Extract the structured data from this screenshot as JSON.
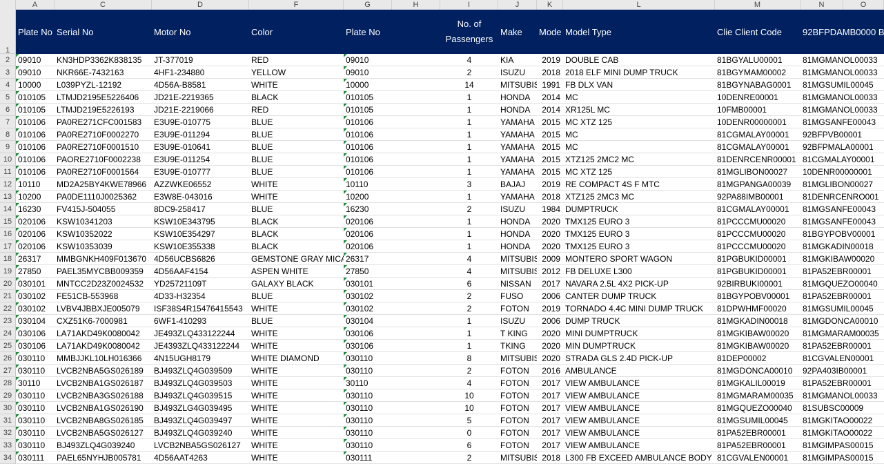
{
  "column_letters": [
    "A",
    "C",
    "D",
    "F",
    "G",
    "H",
    "I",
    "J",
    "K",
    "L",
    "M",
    "N",
    "O"
  ],
  "header": {
    "plate_no": "Plate No",
    "serial_no": "Serial No",
    "motor_no": "Motor No",
    "color": "Color",
    "plate_no_2": "Plate No",
    "passengers": "No. of Passengers",
    "make": "Make",
    "model_year": "Mode",
    "model_type": "Model Type",
    "client": "Clie Client Code",
    "code2": "92BFPDAMB0000 B"
  },
  "header_fill": "#002060",
  "rows": [
    {
      "n": "2",
      "plate": "09010",
      "serial": "KN3HDP3362K838135",
      "motor": "JT-377019",
      "color": "RED",
      "plate2": "09010",
      "pax": "4",
      "make": "KIA",
      "year": "2019",
      "type": "DOUBLE CAB",
      "client": "81BGYALU00001",
      "code2": "81MGMANOL00033"
    },
    {
      "n": "3",
      "plate": "09010",
      "serial": "NKR66E-7432163",
      "motor": "4HF1-234880",
      "color": "YELLOW",
      "plate2": "09010",
      "pax": "2",
      "make": "ISUZU",
      "year": "2018",
      "type": "2018 ELF MINI DUMP TRUCK",
      "client": "81BGYMAM00002",
      "code2": "81MGMANOL00033"
    },
    {
      "n": "4",
      "plate": "10000",
      "serial": "L039PYZL-12192",
      "motor": "4D56A-B8581",
      "color": "WHITE",
      "plate2": "10000",
      "pax": "14",
      "make": "MITSUBISHI",
      "year": "1991",
      "type": "FB DLX VAN",
      "client": "81BGYNABAG0001",
      "code2": "81MGSUMIL00045"
    },
    {
      "n": "5",
      "plate": "010105",
      "serial": "LTMJD2195E5226406",
      "motor": "JD21E-2219365",
      "color": "BLACK",
      "plate2": "010105",
      "pax": "1",
      "make": "HONDA",
      "year": "2014",
      "type": "MC",
      "client": "10DENRE00001",
      "code2": "81MGMANOL00033"
    },
    {
      "n": "6",
      "plate": "010105",
      "serial": "LTMJD219E5226193",
      "motor": "JD21E-2219066",
      "color": "RED",
      "plate2": "010105",
      "pax": "1",
      "make": "HONDA",
      "year": "2014",
      "type": "XR125L MC",
      "client": "10FMB00001",
      "code2": "81MGMANOL00033"
    },
    {
      "n": "7",
      "plate": "010106",
      "serial": "PA0RE271CFC001583",
      "motor": "E3U9E-010775",
      "color": "BLUE",
      "plate2": "010106",
      "pax": "1",
      "make": "YAMAHA",
      "year": "2015",
      "type": "MC XTZ 125",
      "client": "10DENR00000001",
      "code2": "81MGSANFE00043"
    },
    {
      "n": "8",
      "plate": "010106",
      "serial": "PA0RE2710F0002270",
      "motor": "E3U9E-011294",
      "color": "BLUE",
      "plate2": "010106",
      "pax": "1",
      "make": "YAMAHA",
      "year": "2015",
      "type": "MC",
      "client": "81CGMALAY00001",
      "code2": "92BFPVB00001"
    },
    {
      "n": "9",
      "plate": "010106",
      "serial": "PA0RE2710F0001510",
      "motor": "E3U9E-010641",
      "color": "BLUE",
      "plate2": "010106",
      "pax": "1",
      "make": "YAMAHA",
      "year": "2015",
      "type": "MC",
      "client": "81CGMALAY00001",
      "code2": "92BFPMALA00001"
    },
    {
      "n": "10",
      "plate": "010106",
      "serial": "PAORE2710F0002238",
      "motor": "E3U9E-011254",
      "color": "BLUE",
      "plate2": "010106",
      "pax": "1",
      "make": "YAMAHA",
      "year": "2015",
      "type": "XTZ125  2MC2  MC",
      "client": "81DENRCENR00001",
      "code2": "81CGMALAY00001"
    },
    {
      "n": "11",
      "plate": "010106",
      "serial": "PA0RE2710F0001564",
      "motor": "E3U9E-010777",
      "color": "BLUE",
      "plate2": "010106",
      "pax": "1",
      "make": "YAMAHA",
      "year": "2015",
      "type": "MC XTZ 125",
      "client": "81MGLIBON00027",
      "code2": "10DENR00000001"
    },
    {
      "n": "12",
      "plate": "10110",
      "serial": "MD2A25BY4KWE78966",
      "motor": "AZZWKE06552",
      "color": "WHITE",
      "plate2": "10110",
      "pax": "3",
      "make": "BAJAJ",
      "year": "2019",
      "type": "RE COMPACT 4S F MTC",
      "client": "81MGPANGA00039",
      "code2": "81MGLIBON00027"
    },
    {
      "n": "13",
      "plate": "10200",
      "serial": "PA0DE1110J0025362",
      "motor": "E3W8E-043016",
      "color": "WHITE",
      "plate2": "10200",
      "pax": "1",
      "make": "YAMAHA",
      "year": "2018",
      "type": "XTZ125 2MC3 MC",
      "client": "92PA88IMB00001",
      "code2": "81DENRCENRO001"
    },
    {
      "n": "14",
      "plate": "16230",
      "serial": "FV415J-504055",
      "motor": "8DC9-258417",
      "color": "BLUE",
      "plate2": "16230",
      "pax": "2",
      "make": "ISUZU",
      "year": "1984",
      "type": "DUMPTRUCK",
      "client": "81CGMALAY00001",
      "code2": "81MGSANFE00043"
    },
    {
      "n": "15",
      "plate": "020106",
      "serial": "KSW10341203",
      "motor": "KSW10E343795",
      "color": "BLACK",
      "plate2": "020106",
      "pax": "1",
      "make": "HONDA",
      "year": "2020",
      "type": "TMX125 EURO 3",
      "client": "81PCCCMU00020",
      "code2": "81MGSANFE00043"
    },
    {
      "n": "16",
      "plate": "020106",
      "serial": "KSW10352022",
      "motor": "KSW10E354297",
      "color": "BLACK",
      "plate2": "020106",
      "pax": "1",
      "make": "HONDA",
      "year": "2020",
      "type": "TMX125 EURO 3",
      "client": "81PCCCMU00020",
      "code2": "81BGYPOBV00001"
    },
    {
      "n": "17",
      "plate": "020106",
      "serial": "KSW10353039",
      "motor": "KSW10E355338",
      "color": "BLACK",
      "plate2": "020106",
      "pax": "1",
      "make": "HONDA",
      "year": "2020",
      "type": "TMX125 EURO 3",
      "client": "81PCCCMU00020",
      "code2": "81MGKADIN00018"
    },
    {
      "n": "18",
      "plate": "26317",
      "serial": "MMBGNKH409F013670",
      "motor": "4D56UCBS6826",
      "color": "GEMSTONE GRAY MICA",
      "plate2": "26317",
      "pax": "4",
      "make": "MITSUBISHI",
      "year": "2009",
      "type": "MONTERO SPORT WAGON",
      "client": "81PGBUKID00001",
      "code2": "81MGKIBAW00020"
    },
    {
      "n": "19",
      "plate": "27850",
      "serial": "PAEL35MYCBB009359",
      "motor": "4D56AAF4154",
      "color": "ASPEN WHITE",
      "plate2": "27850",
      "pax": "4",
      "make": "MITSUBISHI",
      "year": "2012",
      "type": "FB DELUXE L300",
      "client": "81PGBUKID00001",
      "code2": "81PA52EBR00001"
    },
    {
      "n": "20",
      "plate": "030101",
      "serial": "MNTCC2D23Z0024532",
      "motor": "YD25721109T",
      "color": "GALAXY BLACK",
      "plate2": "030101",
      "pax": "6",
      "make": "NISSAN",
      "year": "2017",
      "type": "NAVARA 2.5L 4X2 PICK-UP",
      "client": "92BIRBUKI00001",
      "code2": "81MGQUEZO00040"
    },
    {
      "n": "21",
      "plate": "030102",
      "serial": "FE51CB-553968",
      "motor": "4D33-H32354",
      "color": "BLUE",
      "plate2": "030102",
      "pax": "2",
      "make": "FUSO",
      "year": "2006",
      "type": "CANTER DUMP TRUCK",
      "client": "81BGYPOBV00001",
      "code2": "81PA52EBR00001"
    },
    {
      "n": "22",
      "plate": "030102",
      "serial": "LVBV4JBBXJE005079",
      "motor": "ISF38S4R15476415543",
      "color": "WHITE",
      "plate2": "030102",
      "pax": "2",
      "make": "FOTON",
      "year": "2019",
      "type": "TORNADO 4.4C MINI DUMP TRUCK",
      "client": "81DPWHMF00020",
      "code2": "81MGSUMIL00045"
    },
    {
      "n": "23",
      "plate": "030104",
      "serial": "CXZ51K6-7000981",
      "motor": "6WF1-410293",
      "color": "BLUE",
      "plate2": "030104",
      "pax": "1",
      "make": "ISUZU",
      "year": "2006",
      "type": "DUMP TRUCK",
      "client": "81MGKADIN00018",
      "code2": "81MGDONCA00010"
    },
    {
      "n": "24",
      "plate": "030106",
      "serial": "LA71AKD49K0080042",
      "motor": "JE493ZLQ433122244",
      "color": "WHITE",
      "plate2": "030106",
      "pax": "1",
      "make": "T KING",
      "year": "2020",
      "type": "MINI DUMPTRUCK",
      "client": "81MGKIBAW00020",
      "code2": "81MGMARAM00035"
    },
    {
      "n": "25",
      "plate": "030106",
      "serial": "LA71AKD49K0080042",
      "motor": "JE4393ZLQ433122244",
      "color": "WHITE",
      "plate2": "030106",
      "pax": "1",
      "make": "TKING",
      "year": "2020",
      "type": "MIN DUMPTRUCK",
      "client": "81MGKIBAW00020",
      "code2": "81PA52EBR00001"
    },
    {
      "n": "26",
      "plate": "030110",
      "serial": "MMBJJKL10LH016366",
      "motor": "4N15UGH8179",
      "color": "WHITE DIAMOND",
      "plate2": "030110",
      "pax": "8",
      "make": "MITSUBISHI",
      "year": "2020",
      "type": "STRADA GLS 2.4D PICK-UP",
      "client": "81DEP00002",
      "code2": "81CGVALEN00001"
    },
    {
      "n": "27",
      "plate": "030110",
      "serial": "LVCB2NBA5GS026189",
      "motor": "BJ493ZLQ4G039509",
      "color": "WHITE",
      "plate2": "030110",
      "pax": "2",
      "make": "FOTON",
      "year": "2016",
      "type": " AMBULANCE",
      "client": "81MGDONCA00010",
      "code2": "92PA403IB00001"
    },
    {
      "n": "28",
      "plate": "30110",
      "serial": "LVCB2NBA1GS026187",
      "motor": "BJ493ZLQ4G039503",
      "color": "WHITE",
      "plate2": "30110",
      "pax": "4",
      "make": "FOTON",
      "year": "2017",
      "type": "VIEW  AMBULANCE",
      "client": "81MGKALIL00019",
      "code2": "81PA52EBR00001"
    },
    {
      "n": "29",
      "plate": "030110",
      "serial": "LVCB2NBA3GS026188",
      "motor": "BJ493ZLQ4G039515",
      "color": "WHITE",
      "plate2": "030110",
      "pax": "10",
      "make": "FOTON",
      "year": "2017",
      "type": "VIEW  AMBULANCE",
      "client": "81MGMARAM00035",
      "code2": "81MGMANOL00033"
    },
    {
      "n": "30",
      "plate": "030110",
      "serial": "LVCB2NBA1GS026190",
      "motor": "BJ493ZLG4G039495",
      "color": "WHITE",
      "plate2": "030110",
      "pax": "10",
      "make": "FOTON",
      "year": "2017",
      "type": "VIEW  AMBULANCE",
      "client": "81MGQUEZO00040",
      "code2": "81SUBSC00009"
    },
    {
      "n": "31",
      "plate": "030110",
      "serial": "LVCB2NBA8GS026185",
      "motor": "BJ493ZLQ4G039497",
      "color": "WHITE",
      "plate2": "030110",
      "pax": "5",
      "make": "FOTON",
      "year": "2017",
      "type": "VIEW  AMBULANCE",
      "client": "81MGSUMIL00045",
      "code2": "81MGKITAO00022"
    },
    {
      "n": "32",
      "plate": "030110",
      "serial": "LVCB2NBA5GS026127",
      "motor": "BJ493ZLQ4G039240",
      "color": "WHITE",
      "plate2": "030110",
      "pax": "0",
      "make": "FOTON",
      "year": "2017",
      "type": "VIEW AMBULANCE",
      "client": "81PA52EBR00001",
      "code2": "81MGKITAO00022"
    },
    {
      "n": "33",
      "plate": "030110",
      "serial": "BJ493ZLQ4G039240",
      "motor": "LVCB2NBA5GS026127",
      "color": "WHITE",
      "plate2": "030110",
      "pax": "6",
      "make": "FOTON",
      "year": "2017",
      "type": "VIEW AMBULANCE",
      "client": "81PA52EBR00001",
      "code2": "81MGIMPAS00015"
    },
    {
      "n": "34",
      "plate": "030111",
      "serial": "PAEL65NYHJB005781",
      "motor": "4D56AAT4263",
      "color": "WHITE",
      "plate2": "030111",
      "pax": "2",
      "make": "MITSUBISHI",
      "year": "2018",
      "type": "L300 FB EXCEED AMBULANCE BODY",
      "client": "81CGVALEN00001",
      "code2": "81MGIMPAS00015"
    }
  ]
}
